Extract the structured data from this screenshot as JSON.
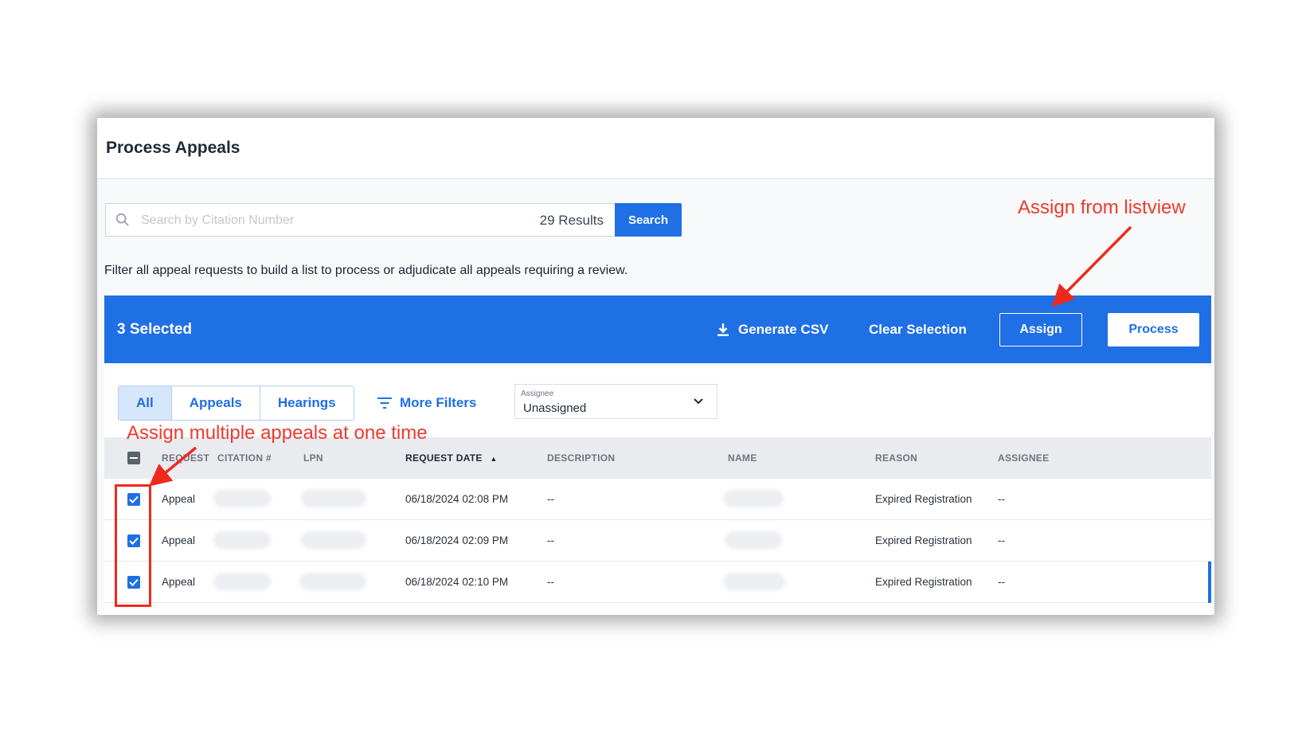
{
  "header": {
    "title": "Process Appeals"
  },
  "search": {
    "placeholder": "Search by Citation Number",
    "results": "29 Results",
    "button_label": "Search"
  },
  "filter_description": "Filter all appeal requests to build a list to process or adjudicate all appeals requiring a review.",
  "action_bar": {
    "selected": "3 Selected",
    "generate_csv": "Generate CSV",
    "clear_selection": "Clear Selection",
    "assign": "Assign",
    "process": "Process"
  },
  "tabs": [
    {
      "label": "All",
      "active": true
    },
    {
      "label": "Appeals",
      "active": false
    },
    {
      "label": "Hearings",
      "active": false
    }
  ],
  "more_filters": "More Filters",
  "assignee_filter": {
    "label": "Assignee",
    "value": "Unassigned"
  },
  "table": {
    "columns": [
      "REQUEST",
      "CITATION #",
      "LPN",
      "REQUEST DATE",
      "DESCRIPTION",
      "NAME",
      "REASON",
      "ASSIGNEE"
    ],
    "sort_indicator": "▲",
    "rows": [
      {
        "request": "Appeal",
        "request_date": "06/18/2024 02:08 PM",
        "description": "--",
        "reason": "Expired Registration",
        "assignee": "--"
      },
      {
        "request": "Appeal",
        "request_date": "06/18/2024 02:09 PM",
        "description": "--",
        "reason": "Expired Registration",
        "assignee": "--"
      },
      {
        "request": "Appeal",
        "request_date": "06/18/2024 02:10 PM",
        "description": "--",
        "reason": "Expired Registration",
        "assignee": "--"
      }
    ]
  },
  "annotations": {
    "assign_listview": "Assign from listview",
    "assign_multiple": "Assign multiple appeals at one time"
  },
  "colors": {
    "primary": "#1f6fe5",
    "annotation": "#ee3a2e"
  }
}
